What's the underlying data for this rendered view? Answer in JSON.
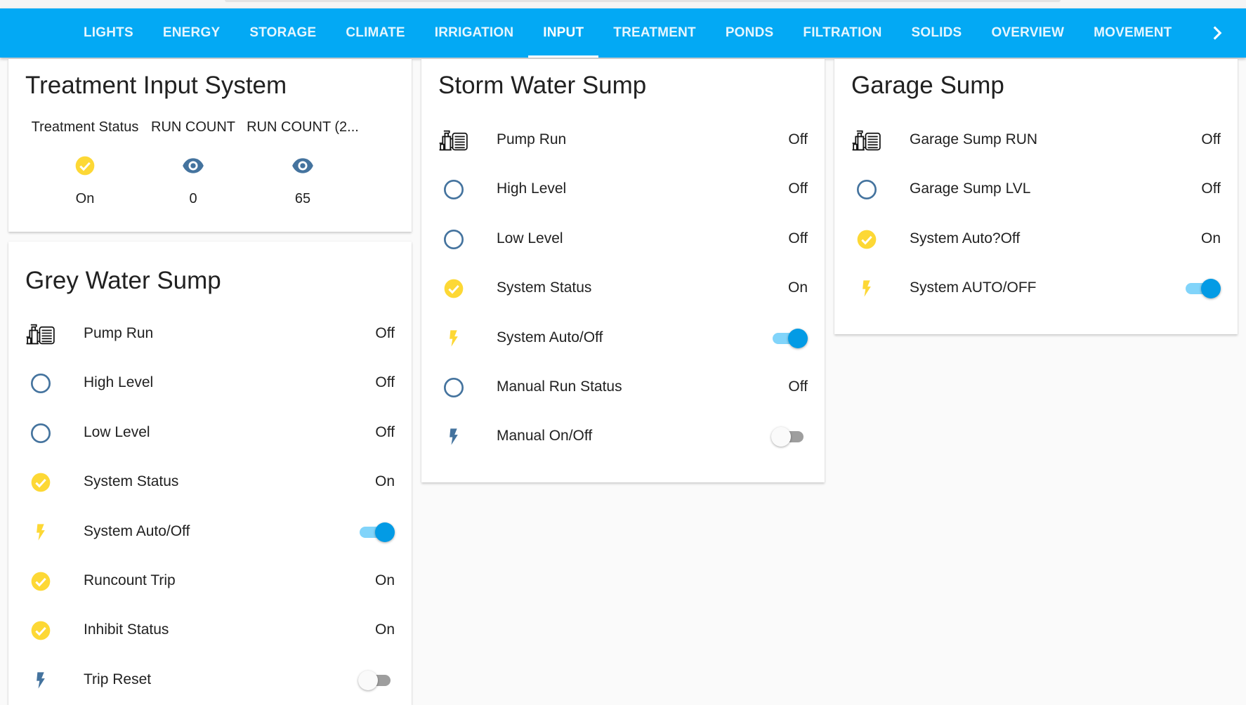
{
  "colors": {
    "accent": "#03a9f4",
    "on_yellow": "#fdd835",
    "off_blue": "#44739e",
    "toggle_on": "#039be5"
  },
  "nav": {
    "tabs": [
      {
        "label": "LIGHTS"
      },
      {
        "label": "ENERGY"
      },
      {
        "label": "STORAGE"
      },
      {
        "label": "CLIMATE"
      },
      {
        "label": "IRRIGATION"
      },
      {
        "label": "INPUT",
        "active": true
      },
      {
        "label": "TREATMENT"
      },
      {
        "label": "PONDS"
      },
      {
        "label": "FILTRATION"
      },
      {
        "label": "SOLIDS"
      },
      {
        "label": "OVERVIEW"
      },
      {
        "label": "MOVEMENT"
      }
    ],
    "more_icon": "chevron-right-icon"
  },
  "treatment_input": {
    "title": "Treatment Input System",
    "entities": [
      {
        "name": "Treatment Status",
        "icon": "check-circle-icon",
        "value": "On"
      },
      {
        "name": "RUN COUNT",
        "icon": "eye-icon",
        "value": "0"
      },
      {
        "name": "RUN COUNT (2...",
        "icon": "eye-icon",
        "value": "65"
      }
    ]
  },
  "grey_water": {
    "title": "Grey Water Sump",
    "rows": [
      {
        "label": "Pump Run",
        "icon": "pump-icon",
        "value": "Off"
      },
      {
        "label": "High Level",
        "icon": "circle-outline-icon",
        "value": "Off"
      },
      {
        "label": "Low Level",
        "icon": "circle-outline-icon",
        "value": "Off"
      },
      {
        "label": "System Status",
        "icon": "check-circle-icon",
        "value": "On"
      },
      {
        "label": "System Auto/Off",
        "icon": "flash-icon",
        "toggle": true,
        "state": "on"
      },
      {
        "label": "Runcount Trip",
        "icon": "check-circle-icon",
        "value": "On"
      },
      {
        "label": "Inhibit Status",
        "icon": "check-circle-icon",
        "value": "On"
      },
      {
        "label": "Trip Reset",
        "icon": "flash-icon",
        "toggle": true,
        "state": "off"
      }
    ]
  },
  "storm_water": {
    "title": "Storm Water Sump",
    "rows": [
      {
        "label": "Pump Run",
        "icon": "pump-icon",
        "value": "Off"
      },
      {
        "label": "High Level",
        "icon": "circle-outline-icon",
        "value": "Off"
      },
      {
        "label": "Low Level",
        "icon": "circle-outline-icon",
        "value": "Off"
      },
      {
        "label": "System Status",
        "icon": "check-circle-icon",
        "value": "On"
      },
      {
        "label": "System Auto/Off",
        "icon": "flash-icon",
        "toggle": true,
        "state": "on"
      },
      {
        "label": "Manual Run Status",
        "icon": "circle-outline-icon",
        "value": "Off"
      },
      {
        "label": "Manual On/Off",
        "icon": "flash-icon",
        "toggle": true,
        "state": "off"
      }
    ]
  },
  "garage": {
    "title": "Garage Sump",
    "rows": [
      {
        "label": "Garage Sump RUN",
        "icon": "pump-icon",
        "value": "Off"
      },
      {
        "label": "Garage Sump LVL",
        "icon": "circle-outline-icon",
        "value": "Off"
      },
      {
        "label": "System Auto?Off",
        "icon": "check-circle-icon",
        "value": "On"
      },
      {
        "label": "System AUTO/OFF",
        "icon": "flash-icon",
        "toggle": true,
        "state": "on"
      }
    ]
  }
}
